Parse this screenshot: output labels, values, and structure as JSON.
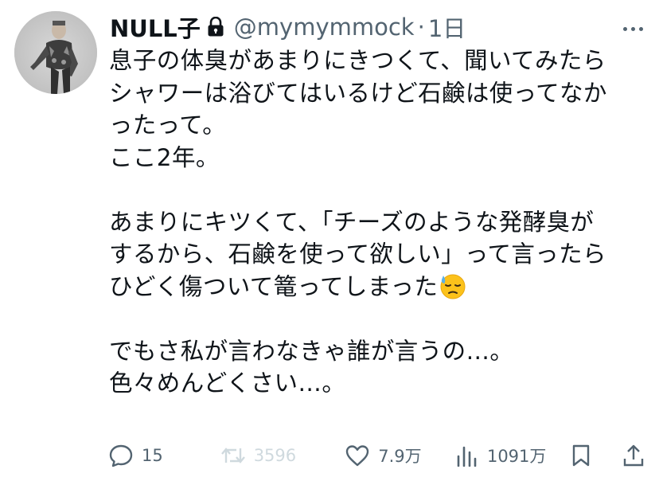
{
  "tweet": {
    "author": {
      "name": "NULL子",
      "handle": "@mymymmock",
      "separator": "·",
      "time": "1日"
    },
    "body_lines": [
      "息子の体臭があまりにきつくて、聞いてみたら",
      "シャワーは浴びてはいるけど石鹸は使ってなか",
      "ったって。",
      "ここ2年。",
      "",
      "あまりにキツくて、「チーズのような発酵臭が",
      "するから、石鹸を使って欲しい」って言ったら",
      "ひどく傷ついて篭ってしまった",
      "",
      "でもさ私が言わなきゃ誰が言うの…。",
      "色々めんどくさい…。"
    ],
    "body_emoji": "downcast-face-with-sweat",
    "stats": {
      "replies": "15",
      "reposts": "3596",
      "likes": "7.9万",
      "views": "1091万"
    }
  },
  "colors": {
    "text": "#0f1419",
    "secondary": "#536471",
    "disabled": "#cfd9de",
    "background": "#ffffff"
  },
  "icons": [
    "lock-icon",
    "more-icon",
    "reply-icon",
    "repost-icon",
    "like-icon",
    "views-icon",
    "bookmark-icon",
    "share-icon"
  ]
}
